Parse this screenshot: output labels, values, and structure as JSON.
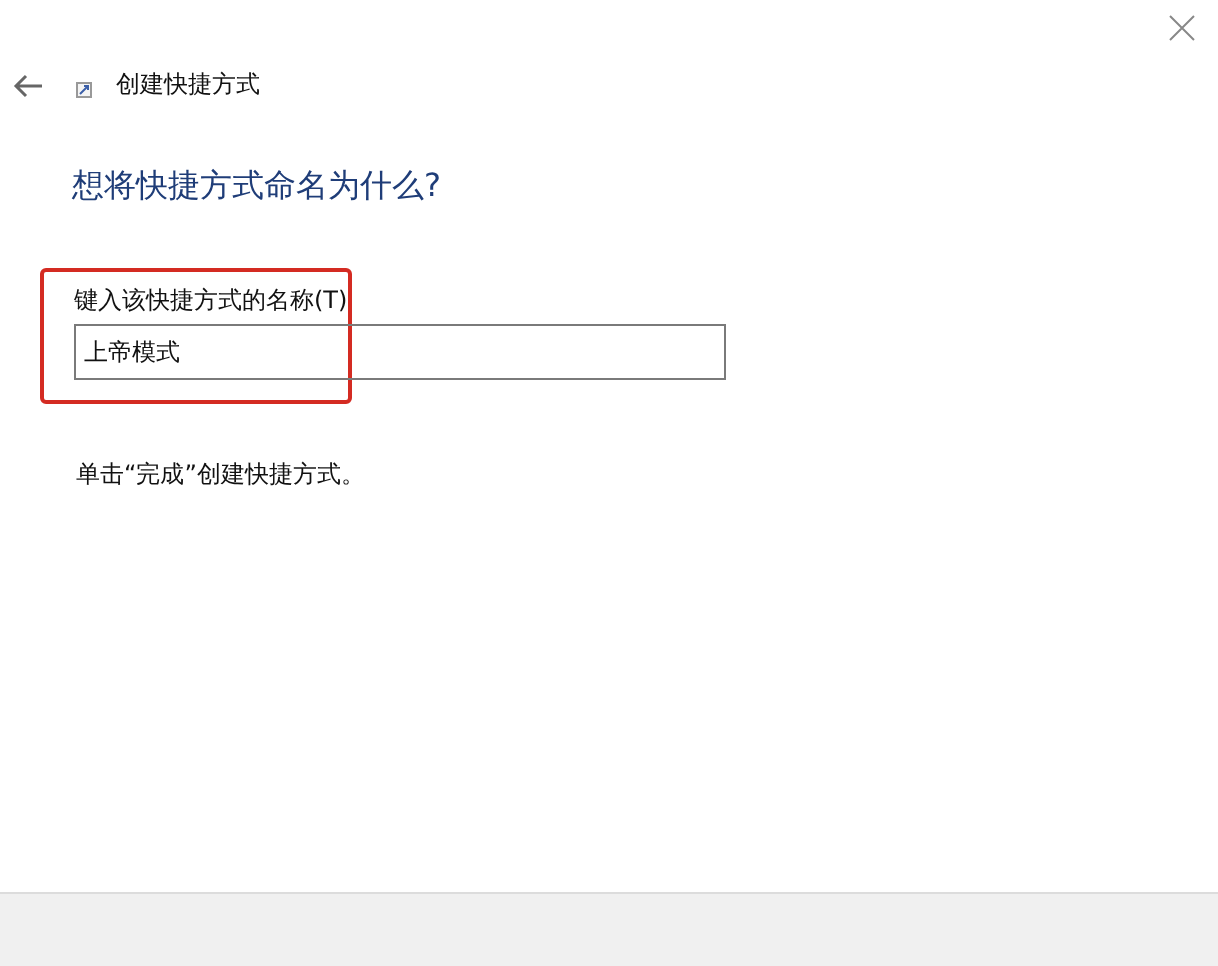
{
  "window": {
    "title": "创建快捷方式"
  },
  "heading": "想将快捷方式命名为什么?",
  "name_field": {
    "label": "键入该快捷方式的名称(T)",
    "value": "上帝模式",
    "highlighted": true
  },
  "instruction": "单击“完成”创建快捷方式。"
}
